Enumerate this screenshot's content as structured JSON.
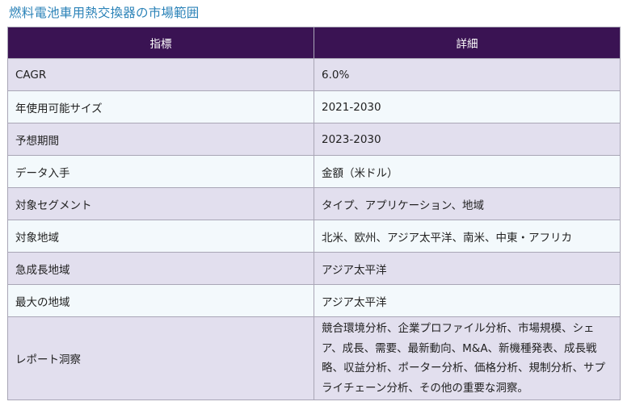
{
  "title": "燃料電池車用熱交換器の市場範囲",
  "table": {
    "headers": [
      "指標",
      "詳細"
    ],
    "rows": [
      {
        "label": "CAGR",
        "value": "6.0%"
      },
      {
        "label": "年使用可能サイズ",
        "value": "2021-2030"
      },
      {
        "label": "予想期間",
        "value": "2023-2030"
      },
      {
        "label": "データ入手",
        "value": "金額（米ドル）"
      },
      {
        "label": "対象セグメント",
        "value": "タイプ、アプリケーション、地域"
      },
      {
        "label": "対象地域",
        "value": "北米、欧州、アジア太平洋、南米、中東・アフリカ"
      },
      {
        "label": "急成長地域",
        "value": "アジア太平洋"
      },
      {
        "label": "最大の地域",
        "value": "アジア太平洋"
      },
      {
        "label": "レポート洞察",
        "value": "競合環境分析、企業プロファイル分析、市場規模、シェア、成長、需要、最新動向、M&A、新機種発表、成長戦略、収益分析、ポーター分析、価格分析、規制分析、サプライチェーン分析、その他の重要な洞察。"
      }
    ]
  }
}
